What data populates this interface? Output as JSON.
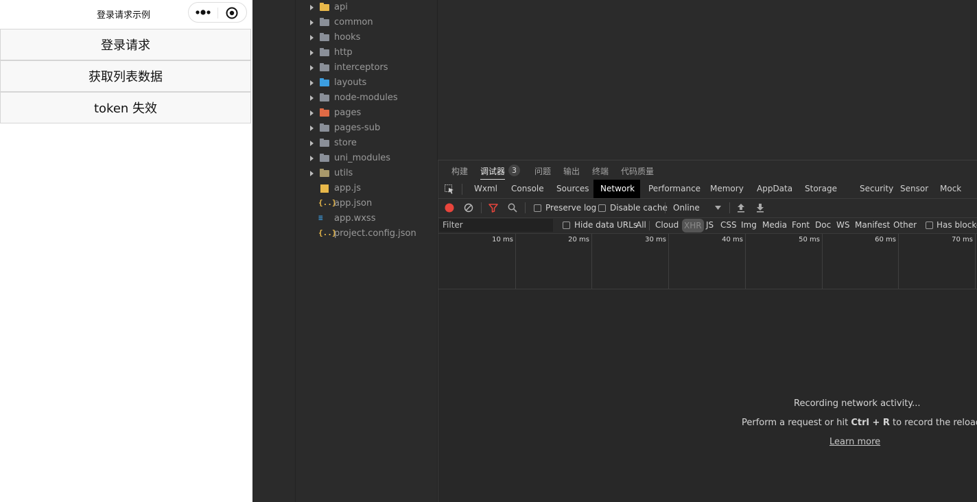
{
  "simulator": {
    "page_title": "登录请求示例",
    "buttons": [
      {
        "label": "登录请求"
      },
      {
        "label": "获取列表数据"
      },
      {
        "label": "token 失效"
      }
    ]
  },
  "file_tree": {
    "items": [
      {
        "name": "api",
        "type": "folder",
        "icon": "api-folder-icon",
        "color": "#e8b84a"
      },
      {
        "name": "common",
        "type": "folder",
        "icon": "folder-icon",
        "color": "#8a8f98"
      },
      {
        "name": "hooks",
        "type": "folder",
        "icon": "hooks-folder-icon",
        "color": "#8a8f98"
      },
      {
        "name": "http",
        "type": "folder",
        "icon": "folder-icon",
        "color": "#8a8f98"
      },
      {
        "name": "interceptors",
        "type": "folder",
        "icon": "folder-icon",
        "color": "#8a8f98"
      },
      {
        "name": "layouts",
        "type": "folder",
        "icon": "layouts-folder-icon",
        "color": "#3c9ee0"
      },
      {
        "name": "node-modules",
        "type": "folder",
        "icon": "folder-icon",
        "color": "#8a8f98"
      },
      {
        "name": "pages",
        "type": "folder",
        "icon": "pages-folder-icon",
        "color": "#e06a45"
      },
      {
        "name": "pages-sub",
        "type": "folder",
        "icon": "folder-icon",
        "color": "#8a8f98"
      },
      {
        "name": "store",
        "type": "folder",
        "icon": "folder-icon",
        "color": "#8a8f98"
      },
      {
        "name": "uni_modules",
        "type": "folder",
        "icon": "folder-icon",
        "color": "#8a8f98"
      },
      {
        "name": "utils",
        "type": "folder",
        "icon": "utils-folder-icon",
        "color": "#a8986a"
      },
      {
        "name": "app.js",
        "type": "file",
        "icon": "js-file-icon",
        "color": "#e8b84a"
      },
      {
        "name": "app.json",
        "type": "file",
        "icon": "json-file-icon",
        "color": "#e8b84a"
      },
      {
        "name": "app.wxss",
        "type": "file",
        "icon": "css-file-icon",
        "color": "#3c9ee0"
      },
      {
        "name": "project.config.json",
        "type": "file",
        "icon": "json-file-icon",
        "color": "#e8b84a"
      }
    ]
  },
  "panel_tabs": {
    "items": [
      "构建",
      "调试器",
      "问题",
      "输出",
      "终端",
      "代码质量"
    ],
    "active": "调试器",
    "debugger_badge": "3"
  },
  "devtools_tabs": {
    "items": [
      "Wxml",
      "Console",
      "Sources",
      "Network",
      "Performance",
      "Memory",
      "AppData",
      "Storage",
      "Security",
      "Sensor",
      "Mock"
    ],
    "active": "Network"
  },
  "toolbar": {
    "preserve_log": "Preserve log",
    "disable_cache": "Disable cache",
    "throttle": "Online"
  },
  "filter_bar": {
    "placeholder": "Filter",
    "hide_data_urls": "Hide data URLs",
    "types": [
      "All",
      "Cloud",
      "XHR",
      "JS",
      "CSS",
      "Img",
      "Media",
      "Font",
      "Doc",
      "WS",
      "Manifest",
      "Other"
    ],
    "selected_type": "XHR",
    "has_blocked": "Has blocked cookies"
  },
  "timeline": {
    "ticks": [
      "10 ms",
      "20 ms",
      "30 ms",
      "40 ms",
      "50 ms",
      "60 ms",
      "70 ms"
    ]
  },
  "empty_state": {
    "line1": "Recording network activity...",
    "line2_prefix": "Perform a request or hit ",
    "shortcut": "Ctrl + R",
    "line2_suffix": " to record the reload.",
    "link": "Learn more"
  },
  "colors": {
    "record_button": "#e8453c",
    "filter_icon": "#e8453c",
    "panel_bg": "#282828"
  }
}
